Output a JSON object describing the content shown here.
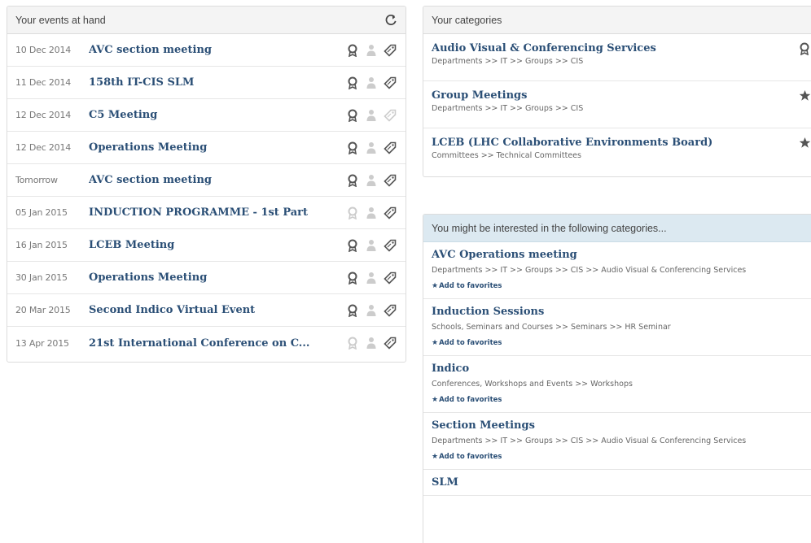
{
  "events_panel": {
    "title": "Your events at hand",
    "events": [
      {
        "date": "10 Dec 2014",
        "title": "AVC section meeting",
        "faded": false
      },
      {
        "date": "11 Dec 2014",
        "title": "158th IT-CIS SLM",
        "faded": false
      },
      {
        "date": "12 Dec 2014",
        "title": "C5 Meeting",
        "faded": false
      },
      {
        "date": "12 Dec 2014",
        "title": "Operations Meeting",
        "faded": false
      },
      {
        "date": "Tomorrow",
        "title": "AVC section meeting",
        "faded": false
      },
      {
        "date": "05 Jan 2015",
        "title": "INDUCTION PROGRAMME - 1st Part",
        "faded": true
      },
      {
        "date": "16 Jan 2015",
        "title": "LCEB Meeting",
        "faded": false
      },
      {
        "date": "30 Jan 2015",
        "title": "Operations Meeting",
        "faded": false
      },
      {
        "date": "20 Mar 2015",
        "title": "Second Indico Virtual Event",
        "faded": false
      },
      {
        "date": "13 Apr 2015",
        "title": "21st International Conference on C...",
        "faded": true
      }
    ]
  },
  "categories_panel": {
    "title": "Your categories",
    "items": [
      {
        "title": "Audio Visual & Conferencing Services",
        "path": "Departments >> IT >> Groups >> CIS",
        "icon": "award-icon"
      },
      {
        "title": "Group Meetings",
        "path": "Departments >> IT >> Groups >> CIS",
        "icon": "star-icon"
      },
      {
        "title": "LCEB (LHC Collaborative Environments Board)",
        "path": "Committees >> Technical Committees",
        "icon": "star-icon"
      }
    ]
  },
  "suggest_panel": {
    "title": "You might be interested in the following categories...",
    "fav_label": "Add to favorites",
    "items": [
      {
        "title": "AVC Operations meeting",
        "path": "Departments >> IT >> Groups >> CIS >> Audio Visual & Conferencing Services"
      },
      {
        "title": "Induction Sessions",
        "path": "Schools, Seminars and Courses >> Seminars >> HR Seminar"
      },
      {
        "title": "Indico",
        "path": "Conferences, Workshops and Events >> Workshops"
      },
      {
        "title": "Section Meetings",
        "path": "Departments >> IT >> Groups >> CIS >> Audio Visual & Conferencing Services"
      },
      {
        "title": "SLM",
        "path": ""
      }
    ]
  },
  "colors": {
    "link": "#2b4f76",
    "icon_dark": "#555555",
    "icon_light": "#cccccc"
  }
}
